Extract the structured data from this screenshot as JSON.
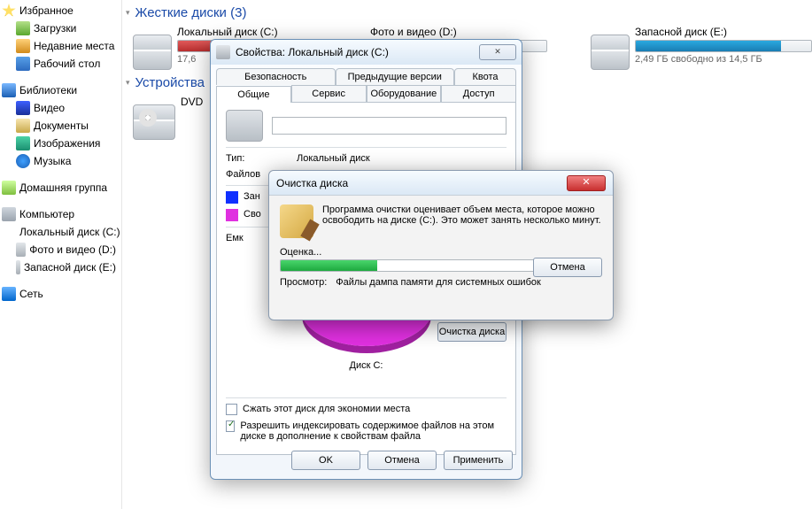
{
  "nav": {
    "favorites": "Избранное",
    "downloads": "Загрузки",
    "recent": "Недавние места",
    "desktop": "Рабочий стол",
    "libraries": "Библиотеки",
    "video": "Видео",
    "documents": "Документы",
    "images": "Изображения",
    "music": "Музыка",
    "homegroup": "Домашняя группа",
    "computer": "Компьютер",
    "diskC": "Локальный диск (C:)",
    "diskD": "Фото и видео (D:)",
    "diskE": "Запасной диск (E:)",
    "network": "Сеть"
  },
  "sections": {
    "hdd_title": "Жесткие диски (3)",
    "rem_title": "Устройства"
  },
  "drives": {
    "c": {
      "name": "Локальный диск (C:)",
      "status": "17,6"
    },
    "d": {
      "name": "Фото и видео (D:)",
      "status": ""
    },
    "e": {
      "name": "Запасной диск (E:)",
      "status": "2,49 ГБ свободно из 14,5 ГБ"
    },
    "dvd": {
      "name": "DVD"
    }
  },
  "props": {
    "title": "Свойства: Локальный диск (C:)",
    "tabs_top": [
      "Безопасность",
      "Предыдущие версии",
      "Квота"
    ],
    "tabs_bottom": [
      "Общие",
      "Сервис",
      "Оборудование",
      "Доступ"
    ],
    "type_label": "Тип:",
    "type_value": "Локальный диск",
    "fs_label": "Файлов",
    "used_label": "Зан",
    "free_label": "Сво",
    "cap_label": "Емк",
    "pie_label": "Диск C:",
    "cleanup_btn": "Очистка диска",
    "chk_compress": "Сжать этот диск для экономии места",
    "chk_index": "Разрешить индексировать содержимое файлов на этом диске в дополнение к свойствам файла",
    "ok": "OK",
    "cancel": "Отмена",
    "apply": "Применить"
  },
  "cleanup": {
    "title": "Очистка диска",
    "msg": "Программа очистки оценивает объем места, которое можно освободить на диске  (C:). Это может занять несколько минут.",
    "estimating": "Оценка...",
    "cancel": "Отмена",
    "scan_label": "Просмотр:",
    "scan_value": "Файлы дампа памяти для системных ошибок"
  }
}
